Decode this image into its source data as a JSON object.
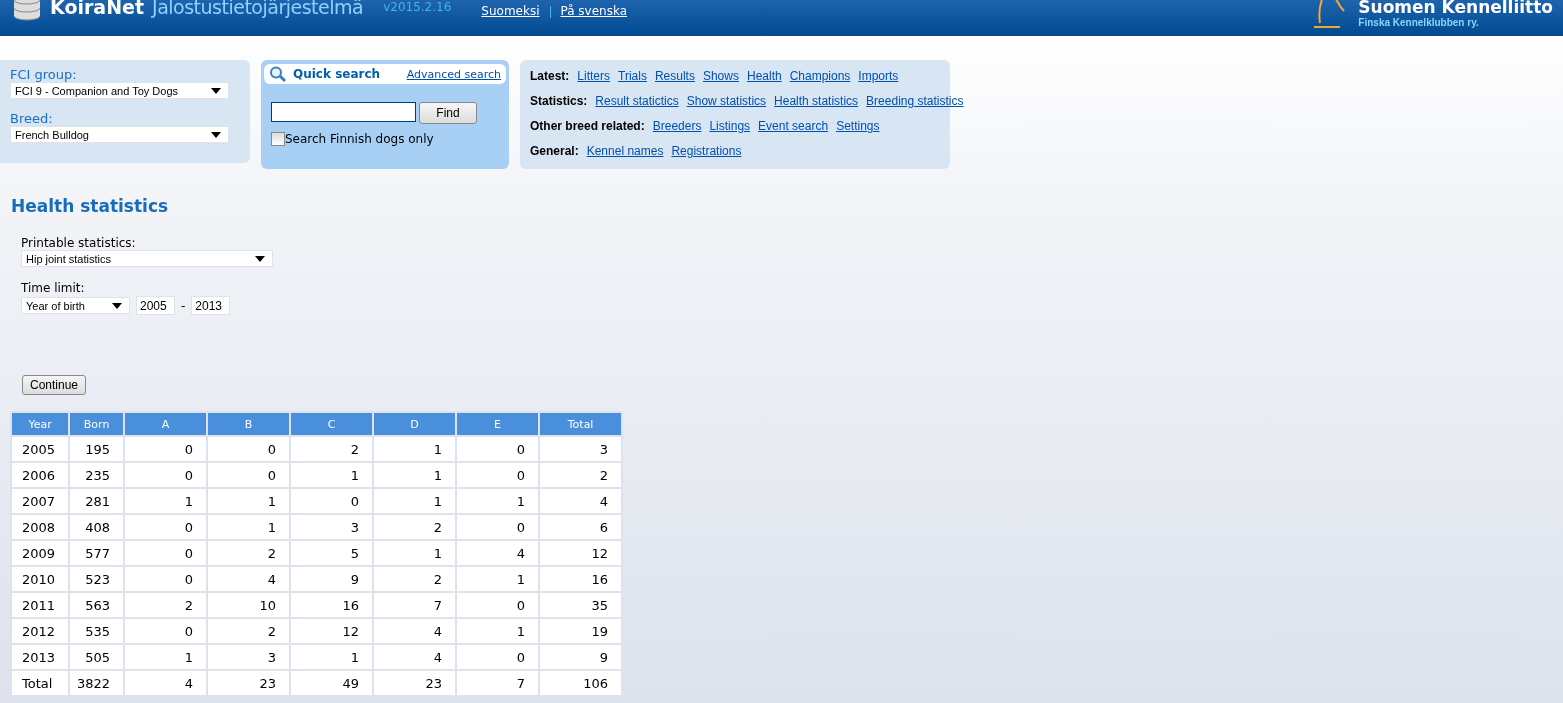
{
  "header": {
    "brand": "KoiraNet",
    "product": "Jalostustietojärjestelmä",
    "version": "v2015.2.16",
    "languages": [
      "Suomeksi",
      "På svenska"
    ],
    "org_name": "Suomen Kennelliitto",
    "org_subtitle": "Finska Kennelklubben ry."
  },
  "breed_panel": {
    "fci_group_label": "FCI group:",
    "fci_group_value": "FCI 9 - Companion and Toy Dogs",
    "breed_label": "Breed:",
    "breed_value": "French Bulldog"
  },
  "quick_search": {
    "title": "Quick search",
    "advanced_link": "Advanced search",
    "find_button": "Find",
    "finnish_only": {
      "label": "Search Finnish dogs only",
      "checked": false
    }
  },
  "link_groups": [
    {
      "label": "Latest:",
      "links": [
        "Litters",
        "Trials",
        "Results",
        "Shows",
        "Health",
        "Champions",
        "Imports"
      ]
    },
    {
      "label": "Statistics:",
      "links": [
        "Result statictics",
        "Show statistics",
        "Health statistics",
        "Breeding statistics"
      ]
    },
    {
      "label": "Other breed related:",
      "links": [
        "Breeders",
        "Listings",
        "Event search",
        "Settings"
      ]
    },
    {
      "label": "General:",
      "links": [
        "Kennel names",
        "Registrations"
      ]
    }
  ],
  "page_title": "Health statistics",
  "form": {
    "printable_label": "Printable statistics:",
    "printable_value": "Hip joint statistics",
    "time_limit_label": "Time limit:",
    "time_limit_type": "Year of birth",
    "year_from": "2005",
    "separator": "-",
    "year_to": "2013",
    "continue_button": "Continue"
  },
  "table": {
    "columns": [
      "Year",
      "Born",
      "A",
      "B",
      "C",
      "D",
      "E",
      "Total"
    ],
    "rows": [
      [
        "2005",
        "195",
        "0",
        "0",
        "2",
        "1",
        "0",
        "3"
      ],
      [
        "2006",
        "235",
        "0",
        "0",
        "1",
        "1",
        "0",
        "2"
      ],
      [
        "2007",
        "281",
        "1",
        "1",
        "0",
        "1",
        "1",
        "4"
      ],
      [
        "2008",
        "408",
        "0",
        "1",
        "3",
        "2",
        "0",
        "6"
      ],
      [
        "2009",
        "577",
        "0",
        "2",
        "5",
        "1",
        "4",
        "12"
      ],
      [
        "2010",
        "523",
        "0",
        "4",
        "9",
        "2",
        "1",
        "16"
      ],
      [
        "2011",
        "563",
        "2",
        "10",
        "16",
        "7",
        "0",
        "35"
      ],
      [
        "2012",
        "535",
        "0",
        "2",
        "12",
        "4",
        "1",
        "19"
      ],
      [
        "2013",
        "505",
        "1",
        "3",
        "1",
        "4",
        "0",
        "9"
      ],
      [
        "Total",
        "3822",
        "4",
        "23",
        "49",
        "23",
        "7",
        "106"
      ]
    ]
  }
}
